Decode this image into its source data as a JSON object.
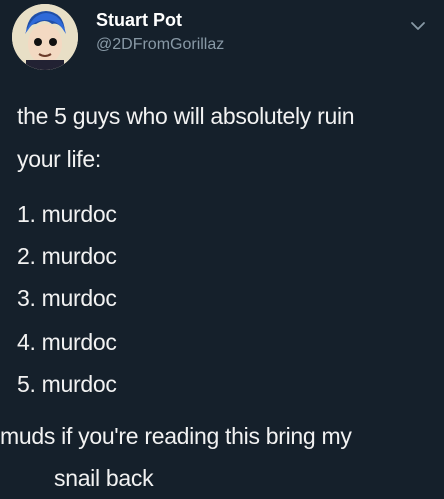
{
  "tweet": {
    "author": {
      "display_name": "Stuart Pot",
      "handle": "@2DFromGorillaz"
    },
    "icons": {
      "menu": "chevron-down-icon",
      "avatar": "cartoon-avatar-image"
    },
    "text": {
      "line1": "the 5 guys who will absolutely ruin",
      "line2": "your life:",
      "list": [
        "1. murdoc",
        "2. murdoc",
        "3. murdoc",
        "4. murdoc",
        "5. murdoc"
      ],
      "line3": "muds if you're reading this bring my",
      "line4": "snail back"
    }
  },
  "colors": {
    "background": "#15202b",
    "text": "#ffffff",
    "secondary": "#8899a6"
  }
}
